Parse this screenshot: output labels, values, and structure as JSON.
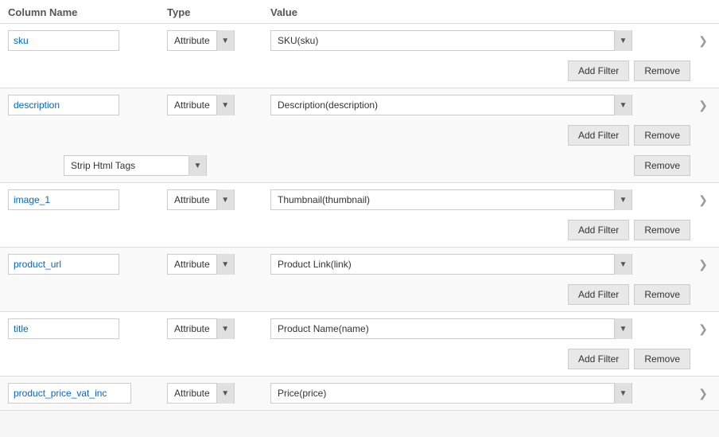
{
  "header": {
    "col_name": "Column Name",
    "col_type": "Type",
    "col_value": "Value"
  },
  "rows": [
    {
      "id": "sku",
      "column_name": "sku",
      "type_label": "Attribute",
      "value_label": "SKU(sku)",
      "has_sub_row": false,
      "show_add_filter": true
    },
    {
      "id": "description",
      "column_name": "description",
      "type_label": "Attribute",
      "value_label": "Description(description)",
      "has_sub_row": true,
      "sub_row_label": "Strip Html Tags",
      "show_add_filter": true
    },
    {
      "id": "image_1",
      "column_name": "image_1",
      "type_label": "Attribute",
      "value_label": "Thumbnail(thumbnail)",
      "has_sub_row": false,
      "show_add_filter": true
    },
    {
      "id": "product_url",
      "column_name": "product_url",
      "type_label": "Attribute",
      "value_label": "Product Link(link)",
      "has_sub_row": false,
      "show_add_filter": true
    },
    {
      "id": "title",
      "column_name": "title",
      "type_label": "Attribute",
      "value_label": "Product Name(name)",
      "has_sub_row": false,
      "show_add_filter": true
    },
    {
      "id": "product_price_vat_inc",
      "column_name": "product_price_vat_inc",
      "type_label": "Attribute",
      "value_label": "Price(price)",
      "has_sub_row": false,
      "show_add_filter": false,
      "partial": true
    }
  ],
  "buttons": {
    "add_filter": "Add Filter",
    "remove": "Remove"
  },
  "chevron": "❯"
}
